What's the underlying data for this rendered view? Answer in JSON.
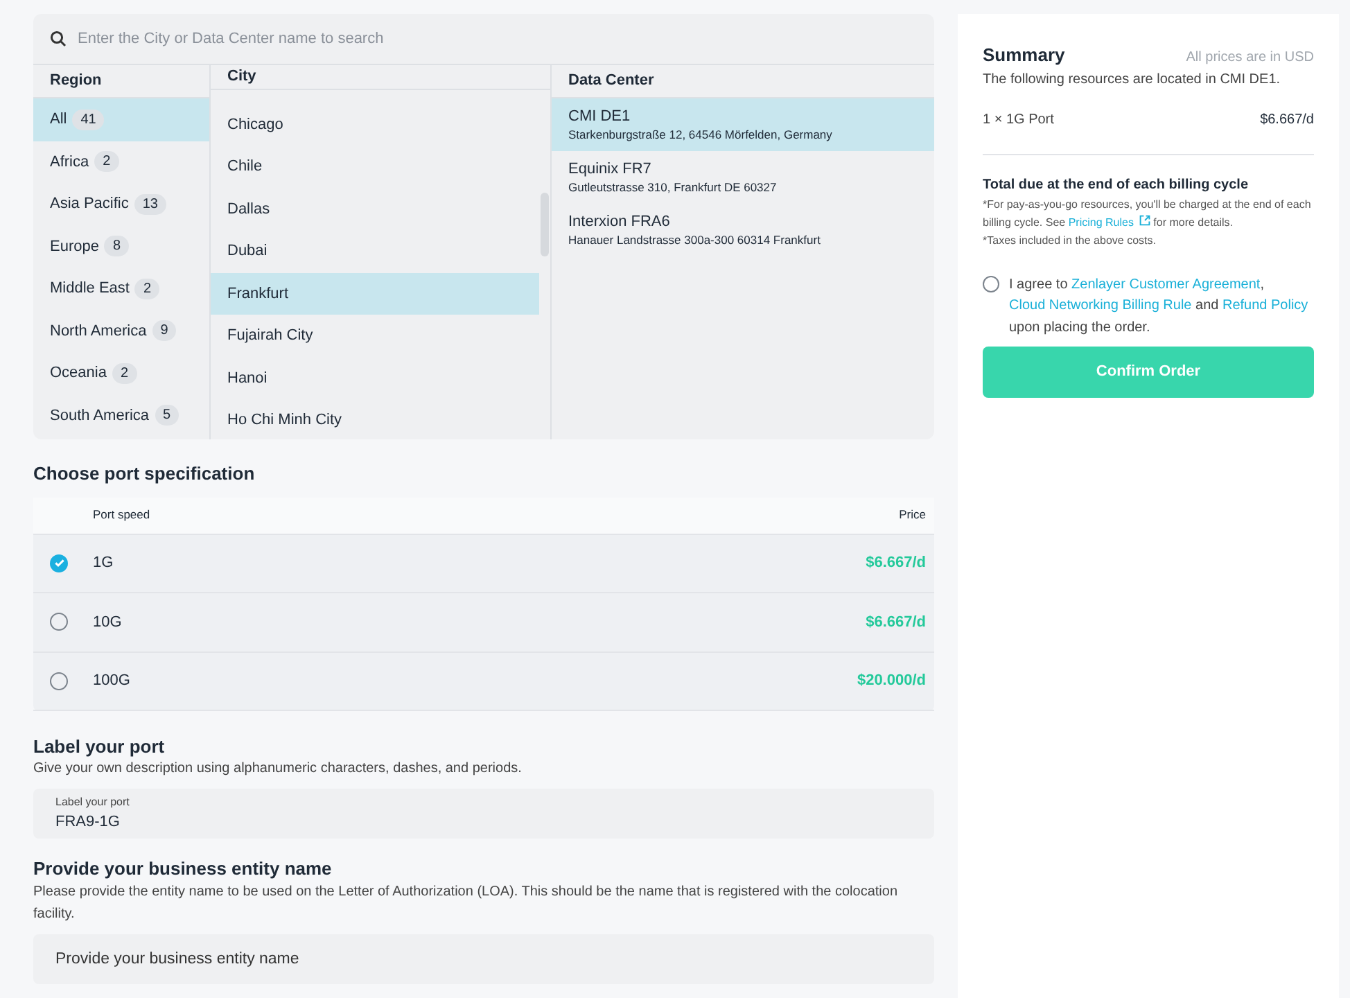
{
  "search": {
    "placeholder": "Enter the City or Data Center name to search"
  },
  "location": {
    "columns": [
      "Region",
      "City",
      "Data Center"
    ],
    "regions": [
      {
        "name": "All",
        "count": "41",
        "selected": true
      },
      {
        "name": "Africa",
        "count": "2",
        "selected": false
      },
      {
        "name": "Asia Pacific",
        "count": "13",
        "selected": false
      },
      {
        "name": "Europe",
        "count": "8",
        "selected": false
      },
      {
        "name": "Middle East",
        "count": "2",
        "selected": false
      },
      {
        "name": "North America",
        "count": "9",
        "selected": false
      },
      {
        "name": "Oceania",
        "count": "2",
        "selected": false
      },
      {
        "name": "South America",
        "count": "5",
        "selected": false
      }
    ],
    "cities": [
      {
        "name": "Chicago",
        "selected": false
      },
      {
        "name": "Chile",
        "selected": false
      },
      {
        "name": "Dallas",
        "selected": false
      },
      {
        "name": "Dubai",
        "selected": false
      },
      {
        "name": "Frankfurt",
        "selected": true
      },
      {
        "name": "Fujairah City",
        "selected": false
      },
      {
        "name": "Hanoi",
        "selected": false
      },
      {
        "name": "Ho Chi Minh City",
        "selected": false
      }
    ],
    "data_centers": [
      {
        "name": "CMI DE1",
        "address": "Starkenburgstraße 12, 64546 Mörfelden, Germany",
        "selected": true
      },
      {
        "name": "Equinix FR7",
        "address": "Gutleutstrasse 310, Frankfurt DE 60327",
        "selected": false
      },
      {
        "name": "Interxion FRA6",
        "address": "Hanauer Landstrasse 300a-300 60314 Frankfurt",
        "selected": false
      }
    ]
  },
  "port_spec": {
    "title": "Choose port specification",
    "columns": [
      "Port speed",
      "Price"
    ],
    "rows": [
      {
        "speed": "1G",
        "price": "$6.667/d",
        "selected": true
      },
      {
        "speed": "10G",
        "price": "$6.667/d",
        "selected": false
      },
      {
        "speed": "100G",
        "price": "$20.000/d",
        "selected": false
      }
    ]
  },
  "label_port": {
    "title": "Label your port",
    "description": "Give your own description using alphanumeric characters, dashes, and periods.",
    "field_label": "Label your port",
    "value": "FRA9-1G"
  },
  "business_entity": {
    "title": "Provide your business entity name",
    "description": "Please provide the entity name to be used on the Letter of Authorization (LOA). This should be the name that is registered with the colocation facility.",
    "placeholder": "Provide your business entity name"
  },
  "summary": {
    "title": "Summary",
    "currency_note": "All prices are in USD",
    "subtitle": "The following resources are located in CMI DE1.",
    "items": [
      {
        "name": "1 × 1G Port",
        "price": "$6.667/d"
      }
    ],
    "total_title": "Total due at the end of each billing cycle",
    "note_parts": [
      {
        "kind": "text",
        "text": "*For pay-as-you-go resources, you'll be charged at the end of each billing cycle. See "
      },
      {
        "kind": "link",
        "text": "Pricing Rules"
      },
      {
        "kind": "text",
        "text": " for more details."
      }
    ],
    "tax_note": "*Taxes included in the above costs.",
    "agree_checked": false,
    "agree_parts": [
      {
        "kind": "text",
        "text": "I agree to "
      },
      {
        "kind": "link",
        "text": "Zenlayer Customer Agreement"
      },
      {
        "kind": "text",
        "text": ", "
      },
      {
        "kind": "link",
        "text": "Cloud Networking Billing Rule"
      },
      {
        "kind": "text",
        "text": " and "
      },
      {
        "kind": "link",
        "text": "Refund Policy"
      },
      {
        "kind": "text",
        "text": " upon placing the order."
      }
    ],
    "confirm_button": "Confirm Order"
  }
}
